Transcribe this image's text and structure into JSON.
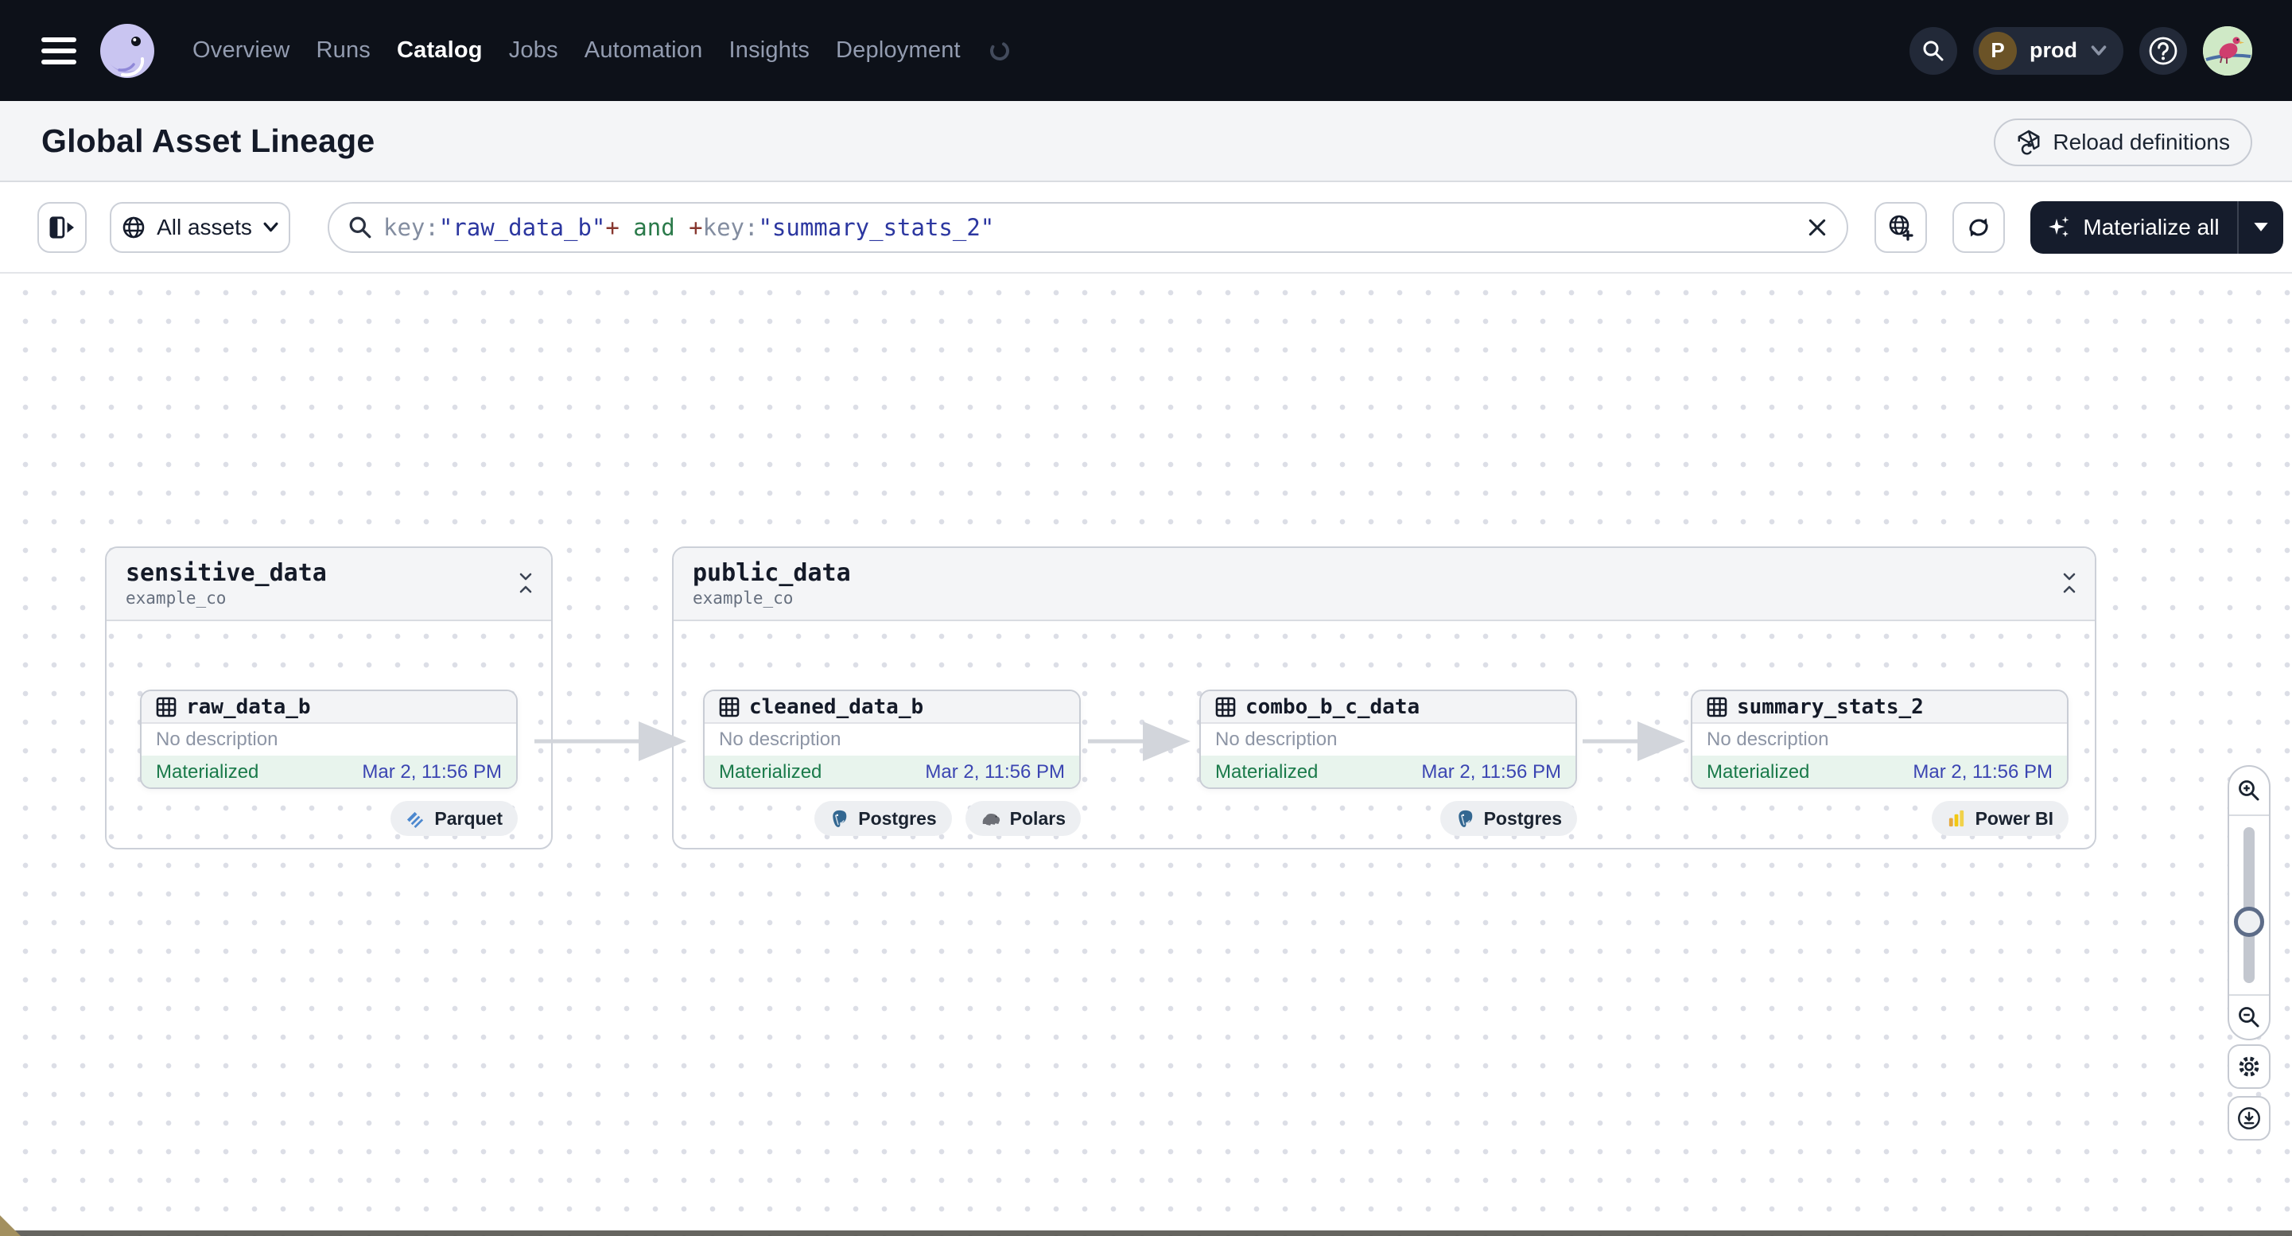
{
  "nav": {
    "items": [
      "Overview",
      "Runs",
      "Catalog",
      "Jobs",
      "Automation",
      "Insights",
      "Deployment"
    ],
    "active_item": "Catalog",
    "deployment": {
      "initial": "P",
      "name": "prod"
    }
  },
  "header": {
    "title": "Global Asset Lineage",
    "reload_button": "Reload definitions"
  },
  "toolbar": {
    "asset_filter": "All assets",
    "materialize_button": "Materialize all",
    "search_query": "key:\"raw_data_b\"+ and +key:\"summary_stats_2\"",
    "search_segments": [
      {
        "text": "key:",
        "type": "field"
      },
      {
        "text": "\"raw_data_b\"",
        "type": "value"
      },
      {
        "text": "+",
        "type": "operator"
      },
      {
        "text": " and ",
        "type": "keyword"
      },
      {
        "text": "+",
        "type": "operator"
      },
      {
        "text": "key:",
        "type": "field"
      },
      {
        "text": "\"summary_stats_2\"",
        "type": "value"
      }
    ]
  },
  "graph": {
    "groups": [
      {
        "name": "sensitive_data",
        "code_location": "example_co"
      },
      {
        "name": "public_data",
        "code_location": "example_co"
      }
    ],
    "nodes": [
      {
        "name": "raw_data_b",
        "description": "No description",
        "status": "Materialized",
        "materialized_at": "Mar 2, 11:56 PM",
        "tags": [
          {
            "label": "Parquet"
          }
        ]
      },
      {
        "name": "cleaned_data_b",
        "description": "No description",
        "status": "Materialized",
        "materialized_at": "Mar 2, 11:56 PM",
        "tags": [
          {
            "label": "Postgres"
          },
          {
            "label": "Polars"
          }
        ]
      },
      {
        "name": "combo_b_c_data",
        "description": "No description",
        "status": "Materialized",
        "materialized_at": "Mar 2, 11:56 PM",
        "tags": [
          {
            "label": "Postgres"
          }
        ]
      },
      {
        "name": "summary_stats_2",
        "description": "No description",
        "status": "Materialized",
        "materialized_at": "Mar 2, 11:56 PM",
        "tags": [
          {
            "label": "Power BI"
          }
        ]
      }
    ]
  },
  "colors": {
    "nav_bg": "#0d1119",
    "dark_accent": "#151c2c",
    "materialized_green": "#1a7a4a",
    "status_bg_green": "#e8f4ed",
    "timestamp_blue": "#3b45b2",
    "query_field": "#838da0",
    "query_value": "#2c37a0",
    "query_operator": "#87372f",
    "query_keyword": "#2b7a4a"
  }
}
